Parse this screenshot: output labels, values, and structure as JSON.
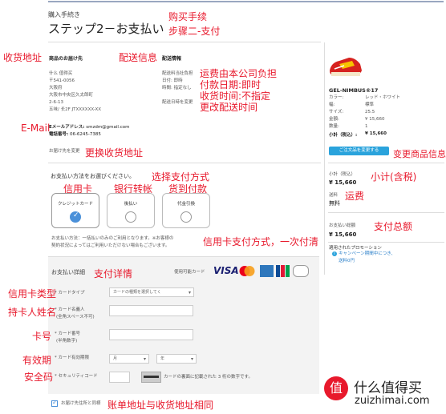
{
  "header": {
    "subtitle": "購入手続き",
    "title": "ステップ2－お支払い",
    "annot_title_1": "购买手续",
    "annot_title_2": "步骤二-支付"
  },
  "shipping_address": {
    "heading": "商品のお届け先",
    "annot_heading": "收货地址",
    "name": "什么 值得买",
    "postal": "〒541-0056",
    "city": "大阪府",
    "ward": "大阪市中央区久太郎町",
    "block": "2-6-13",
    "building": "五味/ 长2F JTXXXXXX-XX",
    "email_label": "Eメールアドレス:",
    "email": "smzdm@gmail.com",
    "phone_label": "電話番号:",
    "phone": "06-6245-7385",
    "annot_email": "E-Mail",
    "change_link": "お届け先を変更",
    "annot_change": "更换收货地址"
  },
  "delivery_info": {
    "heading": "配送情報",
    "annot_heading": "配送信息",
    "line1": "配送料当社負担",
    "line2": "日付: 即時",
    "line3": "時間: 指定なし",
    "change_link": "配送日時を変更",
    "annot_1": "运费由本公司负担",
    "annot_2": "付款日期:即时",
    "annot_3": "收货时间:不指定",
    "annot_4": "更改配送时间"
  },
  "payment_method": {
    "prompt": "お支払い方法をお選びください。",
    "annot_prompt": "选择支付方式",
    "options": [
      {
        "label": "クレジットカード",
        "annot": "信用卡",
        "selected": true
      },
      {
        "label": "後払い",
        "annot": "银行转帐",
        "selected": false
      },
      {
        "label": "代金引換",
        "annot": "货到付款",
        "selected": false
      }
    ],
    "note_1": "お支払い方法：一括払いのみのご利用となります。※お客様の",
    "note_2": "契約状況によってはご利用いただけない場合もございます。",
    "annot_note": "信用卡支付方式，一次付清"
  },
  "payment_details": {
    "heading": "お支払い詳細",
    "annot_heading": "支付详情",
    "accepted_label": "使用可能カード",
    "visa": "VISA",
    "card_type_label": "カードタイプ",
    "card_type_placeholder": "カードの種類を選択してく",
    "annot_card_type": "信用卡类型",
    "holder_label": "カード名義人",
    "holder_sub": "(全角スペース不可)",
    "annot_holder": "持卡人姓名",
    "number_label": "カード番号",
    "number_sub": "(半角数字)",
    "annot_number": "卡号",
    "expiry_label": "カード有効期限",
    "month": "月",
    "year": "年",
    "annot_expiry": "有效期",
    "cvv_label": "セキュリティコード",
    "cvv_note": "カードの裏面に記載された 3 桁の数字です。",
    "annot_cvv": "安全码",
    "billing_same": "お届け先住所と同様",
    "annot_billing": "账单地址与收货地址相同"
  },
  "order_summary": {
    "product_name": "GEL-NIMBUS®17",
    "attrs": [
      {
        "k": "カラー:",
        "v": "レッド・ホワイト"
      },
      {
        "k": "幅:",
        "v": "標準"
      },
      {
        "k": "サイズ:",
        "v": "25.5"
      },
      {
        "k": "金額:",
        "v": "¥ 15,660"
      },
      {
        "k": "数量:",
        "v": "1"
      }
    ],
    "subtotal_row_label": "小計（税込）:",
    "subtotal_row_value": "¥ 15,660",
    "change_order_button": "ご注文品を変更する",
    "annot_change_order": "变更商品信息",
    "subtotal_label": "小計（税込）",
    "annot_subtotal": "小计(含税)",
    "subtotal_value": "¥ 15,660",
    "shipping_label": "送料",
    "annot_shipping": "运费",
    "shipping_value": "無料",
    "total_label": "お支払い総額",
    "annot_total": "支付总额",
    "total_value": "¥ 15,660",
    "promo_label": "適用されたプロモーション",
    "promo_line1": "キャンペーン期間中につき、",
    "promo_line2": "送料0円"
  },
  "watermark": {
    "logo_char": "值",
    "cn": "什么值得买",
    "url": "zuizhimai.com"
  },
  "colors": {
    "annotation": "#e8192c",
    "button_blue": "#2aa3dc",
    "selected_check": "#4a90d9"
  }
}
